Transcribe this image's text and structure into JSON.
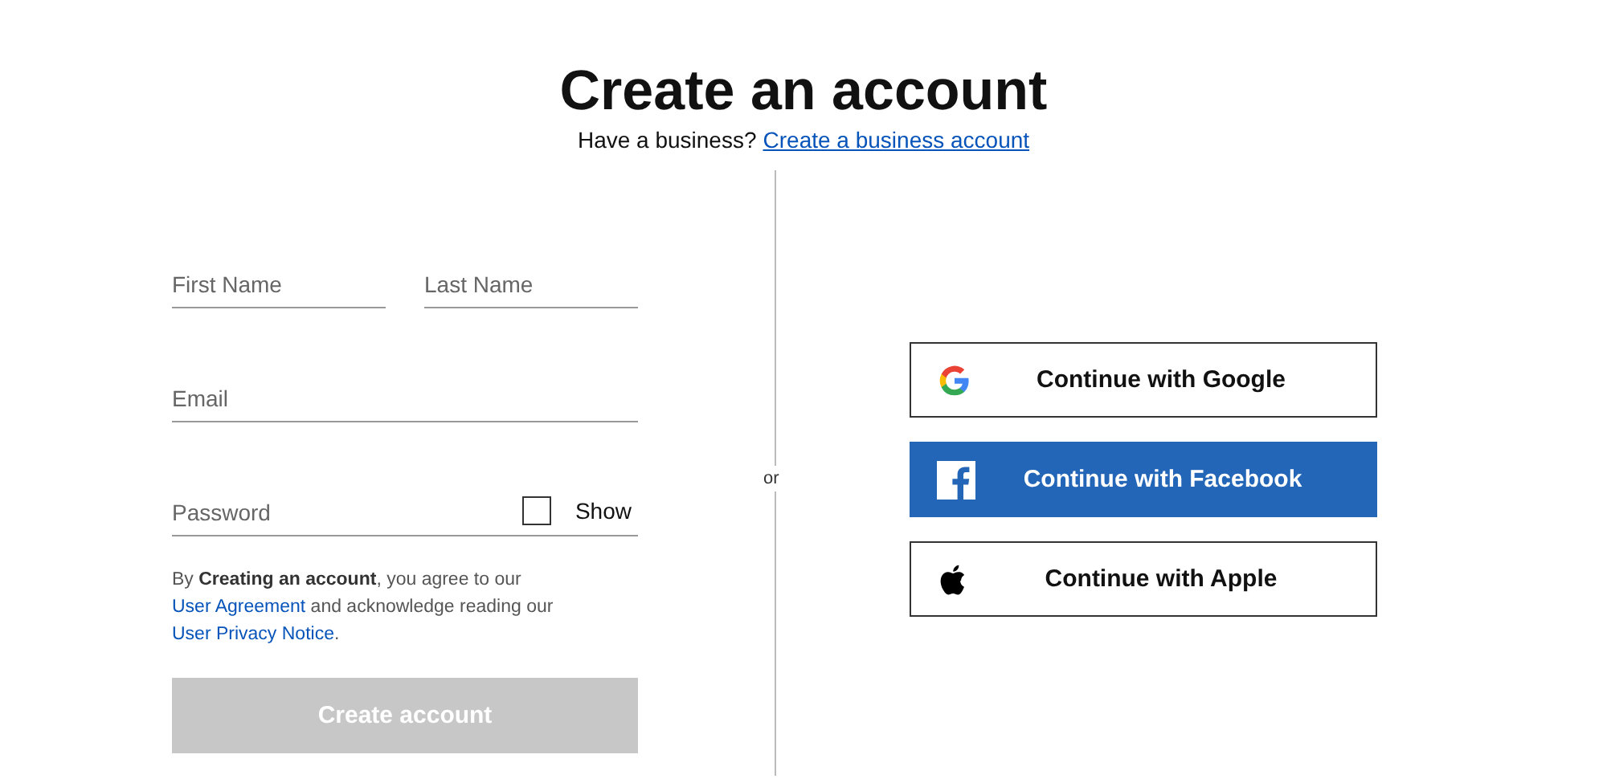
{
  "title": "Create an account",
  "subtitle": {
    "text": "Have a business?",
    "link": "Create a business account"
  },
  "fields": [
    {
      "placeholder": "First Name"
    },
    {
      "placeholder": "Last Name"
    },
    {
      "placeholder": "Email"
    },
    {
      "placeholder": "Password"
    }
  ],
  "show_password": {
    "label": "Show",
    "checked": false
  },
  "legal": [
    {
      "kind": "text",
      "text": "By "
    },
    {
      "kind": "bold",
      "text": "Creating an account"
    },
    {
      "kind": "text",
      "text": ", you agree to our "
    },
    {
      "kind": "link",
      "text": "User Agreement"
    },
    {
      "kind": "text",
      "text": " and acknowledge reading our "
    },
    {
      "kind": "link",
      "text": "User Privacy Notice"
    },
    {
      "kind": "text",
      "text": "."
    }
  ],
  "submit": {
    "label": "Create account",
    "disabled": true
  },
  "separator": "or",
  "social_buttons": [
    {
      "kind": "google",
      "label": "Continue with Google"
    },
    {
      "kind": "facebook",
      "label": "Continue with Facebook"
    },
    {
      "kind": "apple",
      "label": "Continue with Apple"
    }
  ]
}
